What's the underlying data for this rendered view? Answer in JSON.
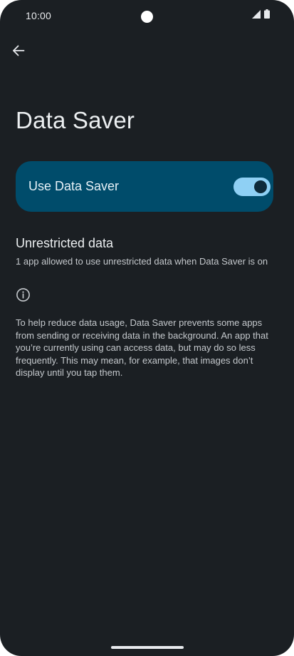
{
  "status_bar": {
    "time": "10:00",
    "icons": [
      "signal-icon",
      "battery-icon"
    ]
  },
  "nav": {
    "back_icon": "arrow-back-icon"
  },
  "page": {
    "title": "Data Saver"
  },
  "data_saver_toggle": {
    "label": "Use Data Saver",
    "checked": true,
    "accent_color": "#004c6b",
    "track_color": "#8fd0f4"
  },
  "unrestricted_data": {
    "title": "Unrestricted data",
    "summary": "1 app allowed to use unrestricted data when Data Saver is on"
  },
  "footer": {
    "icon": "info-icon",
    "text": "To help reduce data usage, Data Saver prevents some apps from sending or receiving data in the background. An app that you’re currently using can access data, but may do so less frequently. This may mean, for example, that images don’t display until you tap them."
  }
}
